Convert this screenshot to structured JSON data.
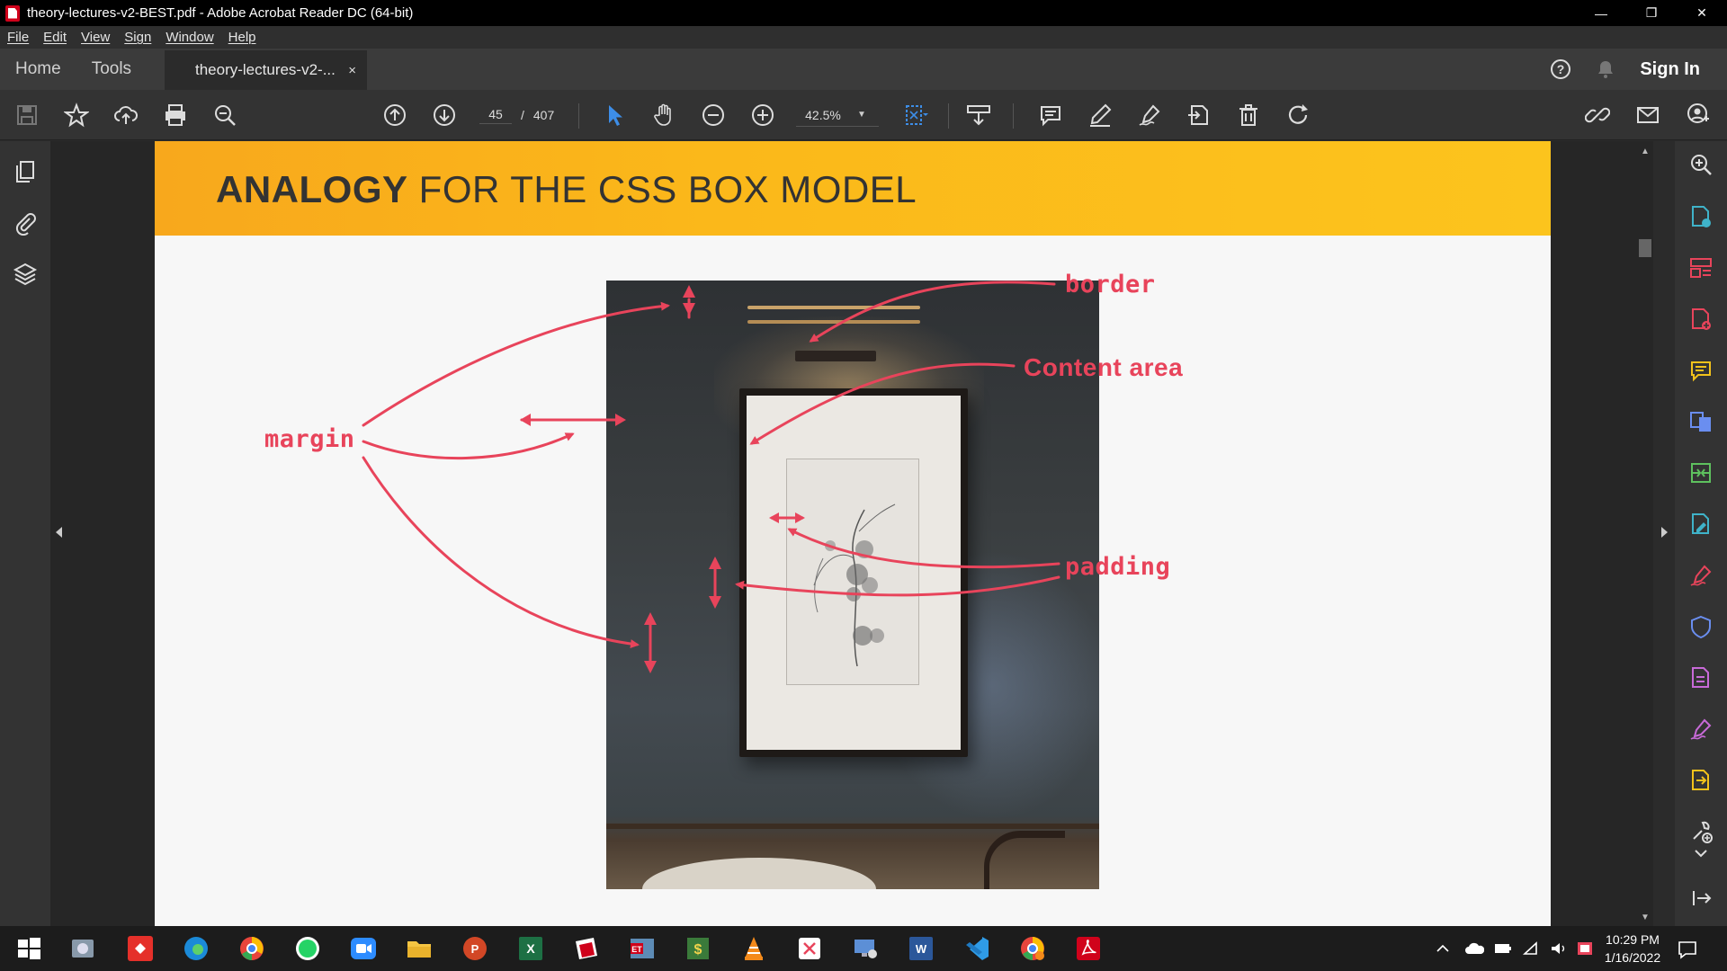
{
  "window": {
    "title": "theory-lectures-v2-BEST.pdf - Adobe Acrobat Reader DC (64-bit)",
    "minimize": "—",
    "restore": "❐",
    "close": "✕"
  },
  "menu": {
    "items": [
      "File",
      "Edit",
      "View",
      "Sign",
      "Window",
      "Help"
    ]
  },
  "tabs": {
    "home": "Home",
    "tools": "Tools",
    "document": "theory-lectures-v2-...",
    "close": "×",
    "sign_in": "Sign In"
  },
  "toolbar": {
    "current_page": "45",
    "page_sep": "/",
    "total_pages": "407",
    "zoom": "42.5%",
    "zoom_dropdown": "▼"
  },
  "slide": {
    "title_bold": "ANALOGY",
    "title_rest": " FOR THE CSS BOX MODEL",
    "labels": {
      "border": "border",
      "content": "Content area",
      "margin": "margin",
      "padding": "padding"
    }
  },
  "scroll": {
    "up": "▲",
    "down": "▼"
  },
  "taskbar": {
    "time": "10:29 PM",
    "date": "1/16/2022"
  },
  "colors": {
    "accent_red": "#e8445b",
    "header_yellow": "#fbb81a",
    "toolbar_blue": "#3d8ee8"
  }
}
